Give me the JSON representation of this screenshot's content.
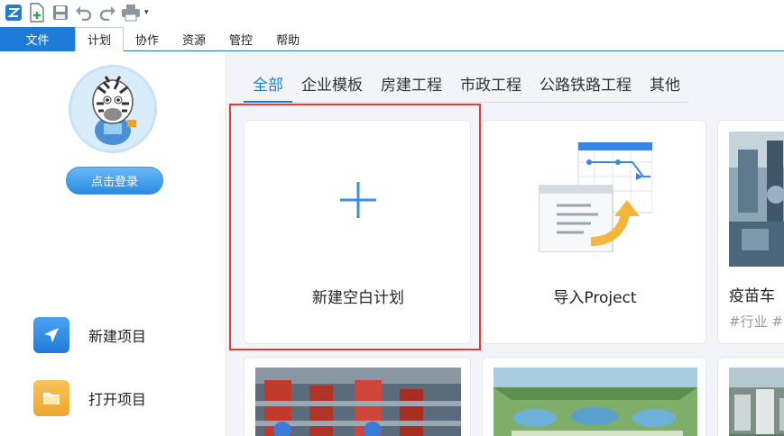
{
  "qat": {
    "items": [
      "app-logo-icon",
      "new-file-icon",
      "save-icon",
      "undo-icon",
      "redo-icon",
      "print-icon"
    ],
    "more": "▾"
  },
  "ribbon": {
    "file": "文件",
    "tabs": [
      "计划",
      "协作",
      "资源",
      "管控",
      "帮助"
    ],
    "active_tab": "计划"
  },
  "sidebar": {
    "login": "点击登录",
    "items": [
      {
        "label": "新建项目",
        "icon": "send-icon",
        "color": "#2b8be6"
      },
      {
        "label": "打开项目",
        "icon": "folder-icon",
        "color": "#f0b43c"
      }
    ]
  },
  "categories": [
    "全部",
    "企业模板",
    "房建工程",
    "市政工程",
    "公路铁路工程",
    "其他"
  ],
  "active_category": "全部",
  "cards": [
    {
      "title": "新建空白计划",
      "icon": "plus-icon"
    },
    {
      "title": "导入Project",
      "icon": "import-project-icon"
    },
    {
      "title": "疫苗车",
      "tag": "#行业 #"
    }
  ],
  "colors": {
    "accent": "#1f7bd8",
    "highlight": "#e03c3c",
    "bg": "#f2f4f7"
  }
}
